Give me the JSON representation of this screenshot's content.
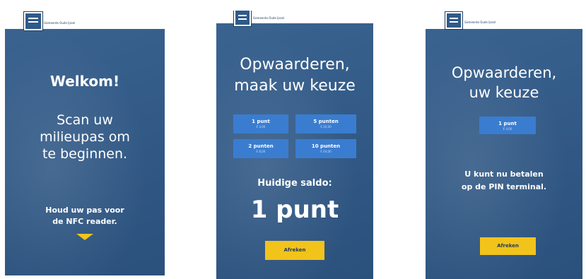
{
  "brand": {
    "name": "Gemeente Oude Ijssel"
  },
  "screen1": {
    "welcome": "Welkom!",
    "scan_line1": "Scan uw",
    "scan_line2": "milieupas om",
    "scan_line3": "te beginnen.",
    "hint_line1": "Houd uw pas voor",
    "hint_line2": "de NFC reader."
  },
  "screen2": {
    "title_line1": "Opwaarderen,",
    "title_line2": "maak uw keuze",
    "options": [
      {
        "label": "1 punt",
        "sub": "€ 4,00"
      },
      {
        "label": "5 punten",
        "sub": "€ 20,00"
      },
      {
        "label": "2 punten",
        "sub": "€ 8,00"
      },
      {
        "label": "10 punten",
        "sub": "€ 40,00"
      }
    ],
    "balance_label": "Huidige saldo:",
    "balance_value": "1 punt",
    "pay_button": "Afreken"
  },
  "screen3": {
    "title_line1": "Opwaarderen,",
    "title_line2": "uw keuze",
    "choice": {
      "label": "1 punt",
      "sub": "€ 4,00"
    },
    "pay_line1": "U kunt nu betalen",
    "pay_line2": "op de PIN terminal.",
    "pay_button": "Afreken"
  }
}
